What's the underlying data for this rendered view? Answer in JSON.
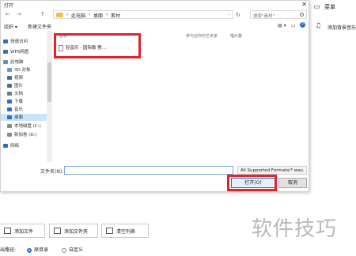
{
  "dialog": {
    "title": "打开",
    "close_glyph": "✕",
    "nav": {
      "back": "←",
      "forward": "→",
      "up": "↑"
    },
    "address": {
      "crumbs": [
        "此电脑",
        "桌面",
        "素材"
      ],
      "sep": "›"
    },
    "search_placeholder": "搜索\"素材\"",
    "toolbar": {
      "organize": "组织 ▾",
      "new_folder": "新建文件夹",
      "help": "?"
    },
    "sidebar": [
      {
        "label": "快速访问",
        "icon": "star-icon",
        "color": "#2c6fc9"
      },
      {
        "label": "WPS网盘",
        "icon": "cloud-icon",
        "color": "#2c6fc9"
      },
      {
        "label": "此电脑",
        "icon": "computer-icon",
        "color": "#6a8fb5"
      },
      {
        "label": "3D 对象",
        "icon": "cube-icon",
        "color": "#5aa0d8"
      },
      {
        "label": "视频",
        "icon": "video-icon",
        "color": "#4c6e96"
      },
      {
        "label": "图片",
        "icon": "picture-icon",
        "color": "#4c6e96"
      },
      {
        "label": "文档",
        "icon": "document-icon",
        "color": "#6d7d8c"
      },
      {
        "label": "下载",
        "icon": "download-icon",
        "color": "#2c6fc9"
      },
      {
        "label": "音乐",
        "icon": "music-icon",
        "color": "#2c6fc9"
      },
      {
        "label": "桌面",
        "icon": "desktop-icon",
        "color": "#2c6fc9",
        "selected": true
      },
      {
        "label": "本地磁盘 (C:)",
        "icon": "disk-icon",
        "color": "#8a8a8a"
      },
      {
        "label": "新加卷 (D:)",
        "icon": "disk-icon",
        "color": "#8a8a8a"
      },
      {
        "label": "网络",
        "icon": "network-icon",
        "color": "#2c6fc9"
      }
    ],
    "columns": [
      "名称",
      "参与创作的艺术家",
      "唱片集"
    ],
    "files": [
      {
        "name": "轻音乐 - 国际歌 警..."
      }
    ],
    "filename_label": "文件名(N):",
    "filename_value": "",
    "filter": "All Supported Formats(*.wav",
    "filter_dd": "⌄",
    "open_label": "打开(O)",
    "cancel_label": "取消"
  },
  "right_app": {
    "menu": "菜单",
    "add_bgm": "添加背景音乐"
  },
  "app": {
    "buttons": [
      "添加文件",
      "添加文件夹",
      "清空列表"
    ],
    "output_label": "出路径:",
    "options": [
      {
        "label": "原目录",
        "checked": true
      },
      {
        "label": "自定义",
        "checked": false
      }
    ]
  },
  "watermark": "软件技巧",
  "colors": {
    "highlight": "#e2232a",
    "accent": "#2c6fc9"
  }
}
